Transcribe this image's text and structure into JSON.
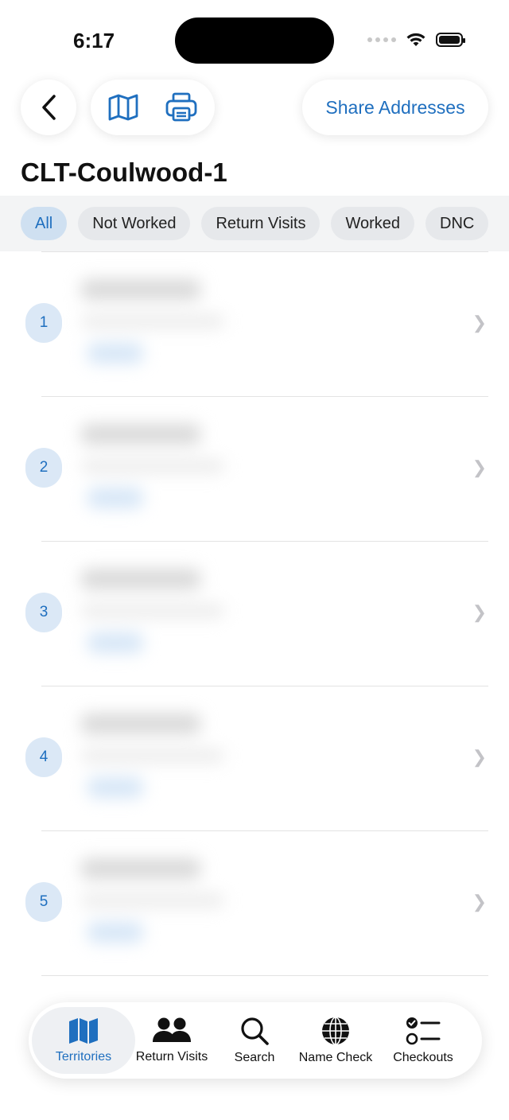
{
  "status_bar": {
    "time": "6:17"
  },
  "top_bar": {
    "back_icon": "chevron-left-icon",
    "map_icon": "map-icon",
    "print_icon": "printer-icon",
    "share_label": "Share Addresses"
  },
  "title": "CLT-Coulwood-1",
  "filters": {
    "chips": [
      {
        "label": "All",
        "active": true
      },
      {
        "label": "Not Worked",
        "active": false
      },
      {
        "label": "Return Visits",
        "active": false
      },
      {
        "label": "Worked",
        "active": false
      },
      {
        "label": "DNC",
        "active": false
      }
    ]
  },
  "list": {
    "rows": [
      {
        "number": "1"
      },
      {
        "number": "2"
      },
      {
        "number": "3"
      },
      {
        "number": "4"
      },
      {
        "number": "5"
      }
    ]
  },
  "tabbar": {
    "tabs": [
      {
        "label": "Territories",
        "icon": "map-fill-icon",
        "active": true
      },
      {
        "label": "Return Visits",
        "icon": "people-icon",
        "active": false
      },
      {
        "label": "Search",
        "icon": "magnifying-glass-icon",
        "active": false
      },
      {
        "label": "Name Check",
        "icon": "globe-icon",
        "active": false
      },
      {
        "label": "Checkouts",
        "icon": "checklist-icon",
        "active": false
      }
    ]
  },
  "colors": {
    "accent": "#1f6fbf",
    "chip_active_bg": "#cfe0f1",
    "badge_bg": "#dbe8f6"
  }
}
